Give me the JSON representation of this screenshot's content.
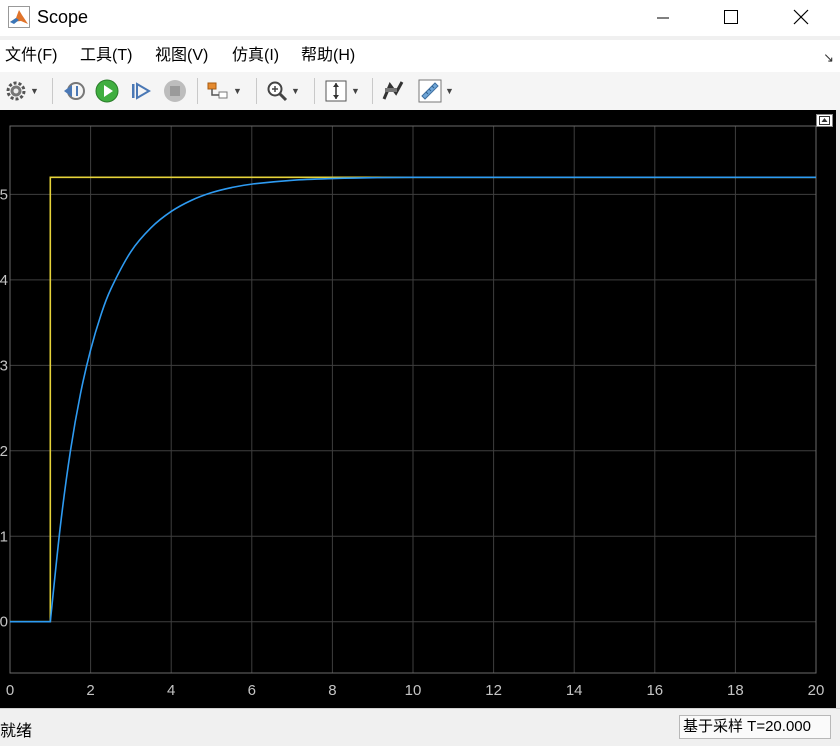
{
  "window": {
    "title": "Scope"
  },
  "menu": [
    "文件(F)",
    "工具(T)",
    "视图(V)",
    "仿真(I)",
    "帮助(H)"
  ],
  "toolbar": {
    "items": [
      "configuration-properties",
      "step-back",
      "run",
      "step-forward",
      "stop",
      "highlight-simulink-block",
      "zoom-in",
      "scale-axes",
      "style",
      "triggers-measurements"
    ]
  },
  "status": {
    "left": "就绪",
    "right": "基于采样  T=20.000"
  },
  "colors": {
    "plot_bg": "#000000",
    "grid": "#3f3f3f",
    "tick_text": "#c4c4c4",
    "input_series": "#e6d33a",
    "output_series": "#2e9bf2"
  },
  "chart_data": {
    "type": "line",
    "title": "",
    "xlabel": "",
    "ylabel": "",
    "xlim": [
      0,
      20
    ],
    "ylim": [
      -0.6,
      5.8
    ],
    "x_ticks": [
      "0",
      "2",
      "4",
      "6",
      "8",
      "10",
      "12",
      "14",
      "16",
      "18",
      "20"
    ],
    "y_ticks": [
      "0",
      "1",
      "2",
      "3",
      "4",
      "5"
    ],
    "grid": true,
    "series": [
      {
        "color": "#e6d33a",
        "x": [
          0,
          1,
          1,
          20
        ],
        "y": [
          0,
          0,
          5.2,
          5.2
        ]
      },
      {
        "color": "#2e9bf2",
        "x": [
          0,
          1,
          1.25,
          1.5,
          1.75,
          2,
          2.25,
          2.5,
          3,
          3.5,
          4,
          4.5,
          5,
          5.5,
          6,
          7,
          8,
          9,
          10,
          12,
          14,
          16,
          18,
          20
        ],
        "y": [
          0,
          0,
          1.12,
          2.0,
          2.67,
          3.18,
          3.58,
          3.89,
          4.33,
          4.61,
          4.8,
          4.93,
          5.02,
          5.08,
          5.12,
          5.165,
          5.185,
          5.195,
          5.2,
          5.2,
          5.2,
          5.2,
          5.2,
          5.2
        ]
      }
    ]
  }
}
